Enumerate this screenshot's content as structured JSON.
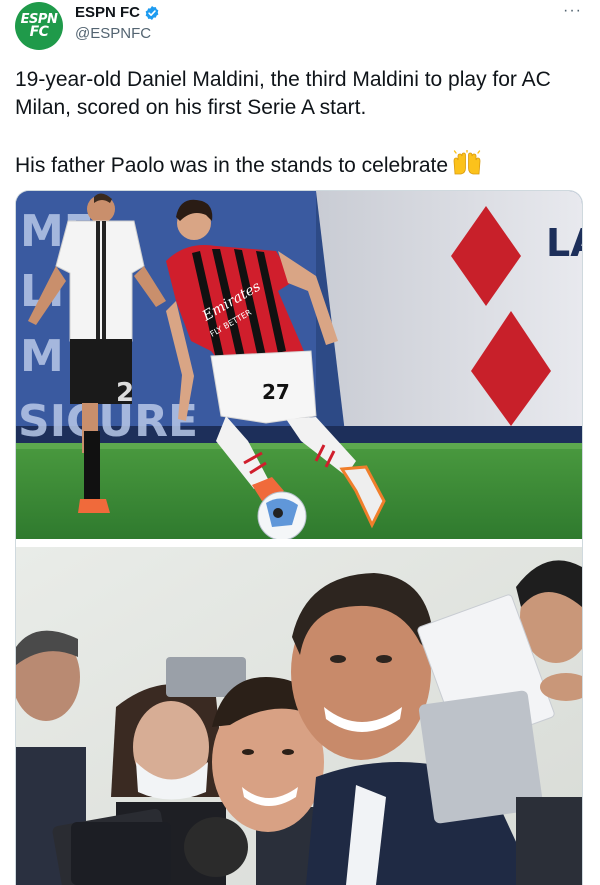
{
  "account": {
    "display_name": "ESPN FC",
    "handle": "@ESPNFC",
    "avatar_text_line1": "ESPN",
    "avatar_text_line2": "FC",
    "avatar_color": "#1f9a4a",
    "verified": true
  },
  "menu": {
    "more_icon": "more-horizontal-icon",
    "more_label": "···"
  },
  "tweet": {
    "paragraph_1": "19-year-old Daniel Maldini, the third Maldini to play for AC Milan, scored on his first Serie A start.",
    "paragraph_2": "His father Paolo was in the stands to celebrate",
    "emoji": "raising-hands"
  },
  "media": {
    "photo_1": {
      "jersey_number": "27",
      "shirt_sponsor_line1": "Emirates",
      "shirt_sponsor_line2": "FLY BETTER",
      "opponent_number": "2",
      "board_text": [
        "ME",
        "LI",
        "M LI",
        "SICURE"
      ],
      "board_text_right": "LA"
    },
    "photo_2": {}
  },
  "colors": {
    "milan_red": "#d01e2c",
    "pitch_green": "#3e8f3a",
    "text_secondary": "#536471",
    "verified_blue": "#1d9bf0"
  }
}
